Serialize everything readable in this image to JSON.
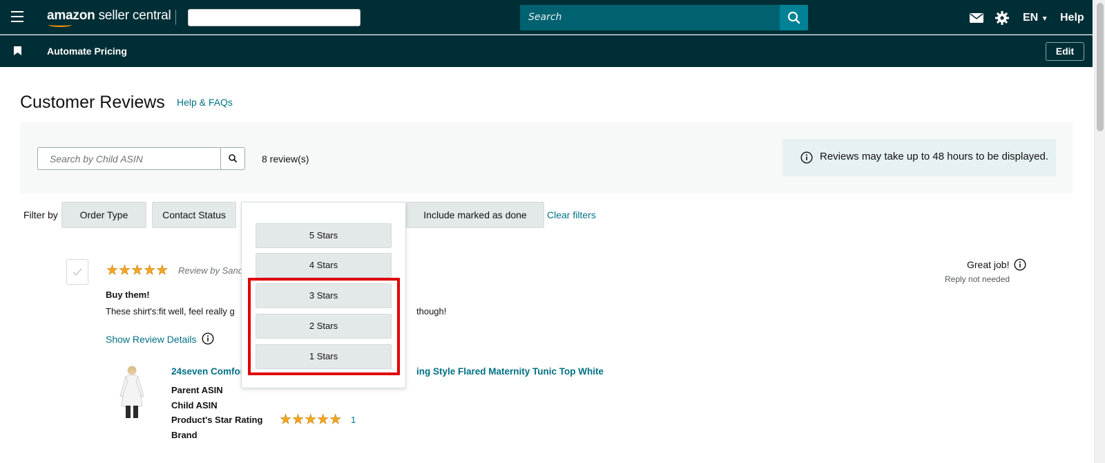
{
  "topnav": {
    "brand_bold": "amazon",
    "brand_light": " seller central",
    "global_search_placeholder": "Search",
    "language": "EN",
    "help": "Help"
  },
  "subnav": {
    "link": "Automate Pricing",
    "edit": "Edit"
  },
  "page": {
    "title": "Customer Reviews",
    "help_link": "Help & FAQs"
  },
  "search": {
    "placeholder": "Search by Child ASIN",
    "review_count": "8 review(s)",
    "notice": "Reviews may take up to 48 hours to be displayed."
  },
  "filters": {
    "label": "Filter by",
    "order_type": "Order Type",
    "contact_status": "Contact Status",
    "include_done": "Include marked as done",
    "clear": "Clear filters"
  },
  "star_dropdown": {
    "options": [
      "5 Stars",
      "4 Stars",
      "3 Stars",
      "2 Stars",
      "1 Stars"
    ],
    "highlighted_options": [
      "3 Stars",
      "2 Stars",
      "1 Stars"
    ]
  },
  "review": {
    "rating": 5,
    "review_by": "Review by Sand",
    "title": "Buy them!",
    "body_start": "These shirt's:fit well, feel really g",
    "body_end": "though!",
    "show_details": "Show Review Details",
    "status": "Great job!",
    "reply_status": "Reply not needed",
    "product": {
      "title_start": "24seven Comfor",
      "title_end": "ing Style Flared Maternity Tunic Top White",
      "labels": [
        "Parent ASIN",
        "Child ASIN",
        "Product's Star Rating",
        "Brand"
      ],
      "star_rating": 5,
      "rating_count": "1"
    }
  },
  "colors": {
    "nav_bg": "#002e36",
    "search_bg": "#006170",
    "search_btn": "#008296",
    "link": "#007185",
    "star": "#f5a623",
    "highlight": "#e00000",
    "notice_bg": "#e6f1f3"
  },
  "icons": {
    "menu": "hamburger-icon",
    "search": "search-icon",
    "mail": "mail-icon",
    "settings": "gear-icon",
    "info": "info-icon",
    "bookmark": "bookmark-icon",
    "check": "check-icon",
    "caret": "caret-down-icon"
  }
}
